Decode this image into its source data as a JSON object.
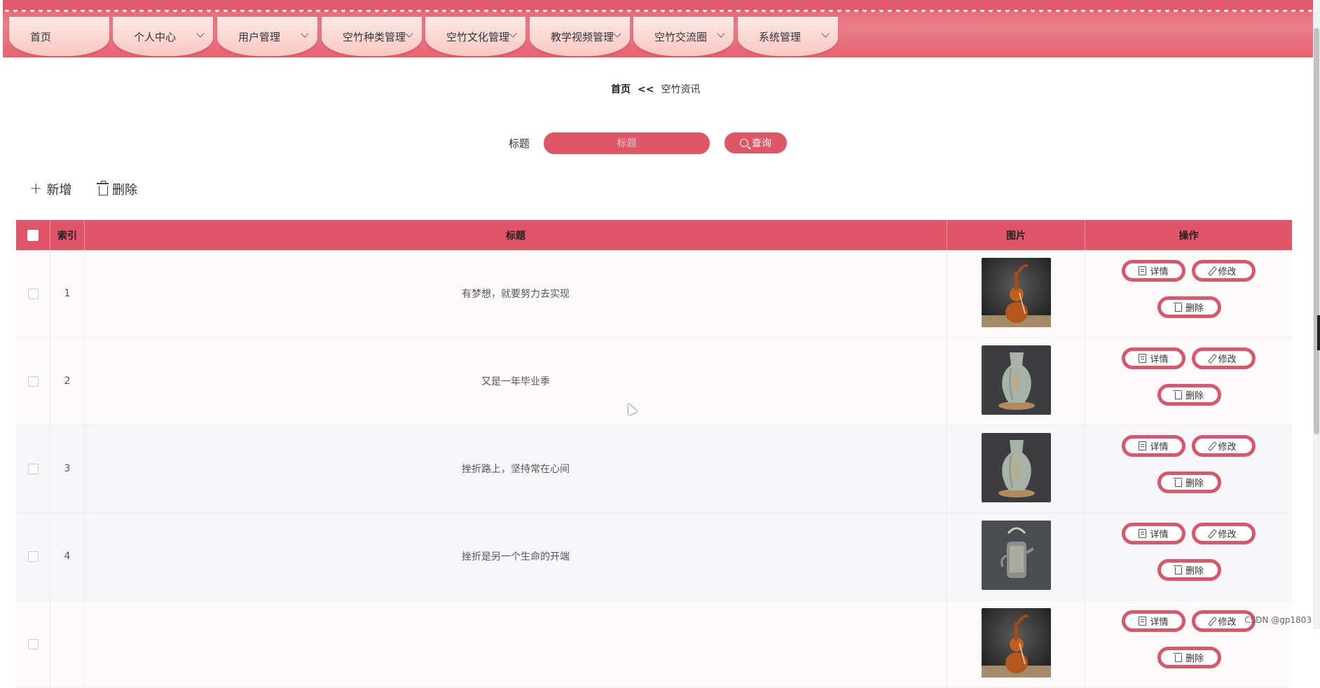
{
  "nav": {
    "items": [
      {
        "label": "首页",
        "has_dropdown": false
      },
      {
        "label": "个人中心",
        "has_dropdown": true
      },
      {
        "label": "用户管理",
        "has_dropdown": true
      },
      {
        "label": "空竹种类管理",
        "has_dropdown": true
      },
      {
        "label": "空竹文化管理",
        "has_dropdown": true
      },
      {
        "label": "教学视频管理",
        "has_dropdown": true
      },
      {
        "label": "空竹交流圈",
        "has_dropdown": true
      },
      {
        "label": "系统管理",
        "has_dropdown": true
      }
    ]
  },
  "breadcrumb": {
    "home": "首页",
    "separator": "<<",
    "current": "空竹资讯"
  },
  "search": {
    "label": "标题",
    "placeholder": "标题",
    "button_label": "查询"
  },
  "toolbar": {
    "add_label": "新增",
    "delete_label": "删除"
  },
  "table": {
    "headers": {
      "index": "索引",
      "title": "标题",
      "image": "图片",
      "actions": "操作"
    },
    "rows": [
      {
        "index": "1",
        "title": "有梦想，就要努力去实现",
        "image": "gourd"
      },
      {
        "index": "2",
        "title": "又是一年毕业季",
        "image": "vase"
      },
      {
        "index": "3",
        "title": "挫折路上，坚持常在心间",
        "image": "vase"
      },
      {
        "index": "4",
        "title": "挫折是另一个生命的开端",
        "image": "teapot"
      },
      {
        "index": "",
        "title": "",
        "image": "gourd"
      }
    ],
    "actions": {
      "detail": "详情",
      "edit": "修改",
      "delete": "删除"
    }
  },
  "colors": {
    "accent": "#df5666",
    "nav_tab": "#f8c8c2"
  },
  "watermark": "CSDN @gp1803"
}
